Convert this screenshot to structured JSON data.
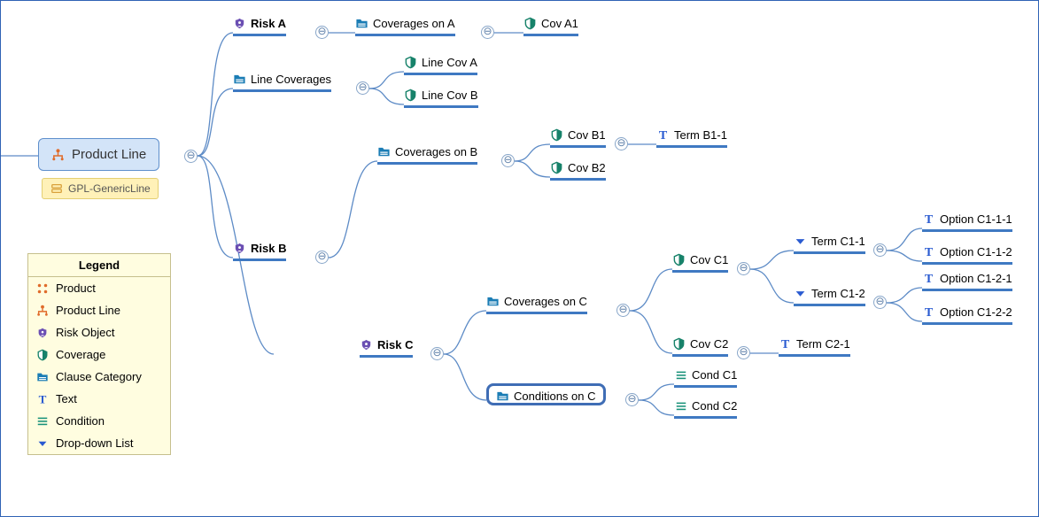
{
  "root": {
    "label": "Product Line",
    "subtype": "GPL-GenericLine"
  },
  "riskA": {
    "label": "Risk A",
    "cat": "Coverages on A",
    "cov": "Cov A1"
  },
  "lineCov": {
    "label": "Line Coverages",
    "a": "Line Cov A",
    "b": "Line Cov B"
  },
  "riskB": {
    "label": "Risk B",
    "cat": "Coverages on B",
    "cov1": "Cov B1",
    "cov2": "Cov B2",
    "term": "Term B1-1"
  },
  "riskC": {
    "label": "Risk C",
    "covCat": "Coverages on C",
    "condCat": "Conditions on C",
    "cov1": "Cov C1",
    "cov2": "Cov C2",
    "term11": "Term C1-1",
    "term12": "Term C1-2",
    "term21": "Term C2-1",
    "op111": "Option C1-1-1",
    "op112": "Option C1-1-2",
    "op121": "Option C1-2-1",
    "op122": "Option C1-2-2",
    "cond1": "Cond C1",
    "cond2": "Cond C2"
  },
  "legend": {
    "title": "Legend",
    "product": "Product",
    "productLine": "Product Line",
    "riskObject": "Risk Object",
    "coverage": "Coverage",
    "clauseCat": "Clause Category",
    "text": "Text",
    "condition": "Condition",
    "dropdown": "Drop-down List"
  },
  "glyph": {
    "collapse": "⊖"
  }
}
